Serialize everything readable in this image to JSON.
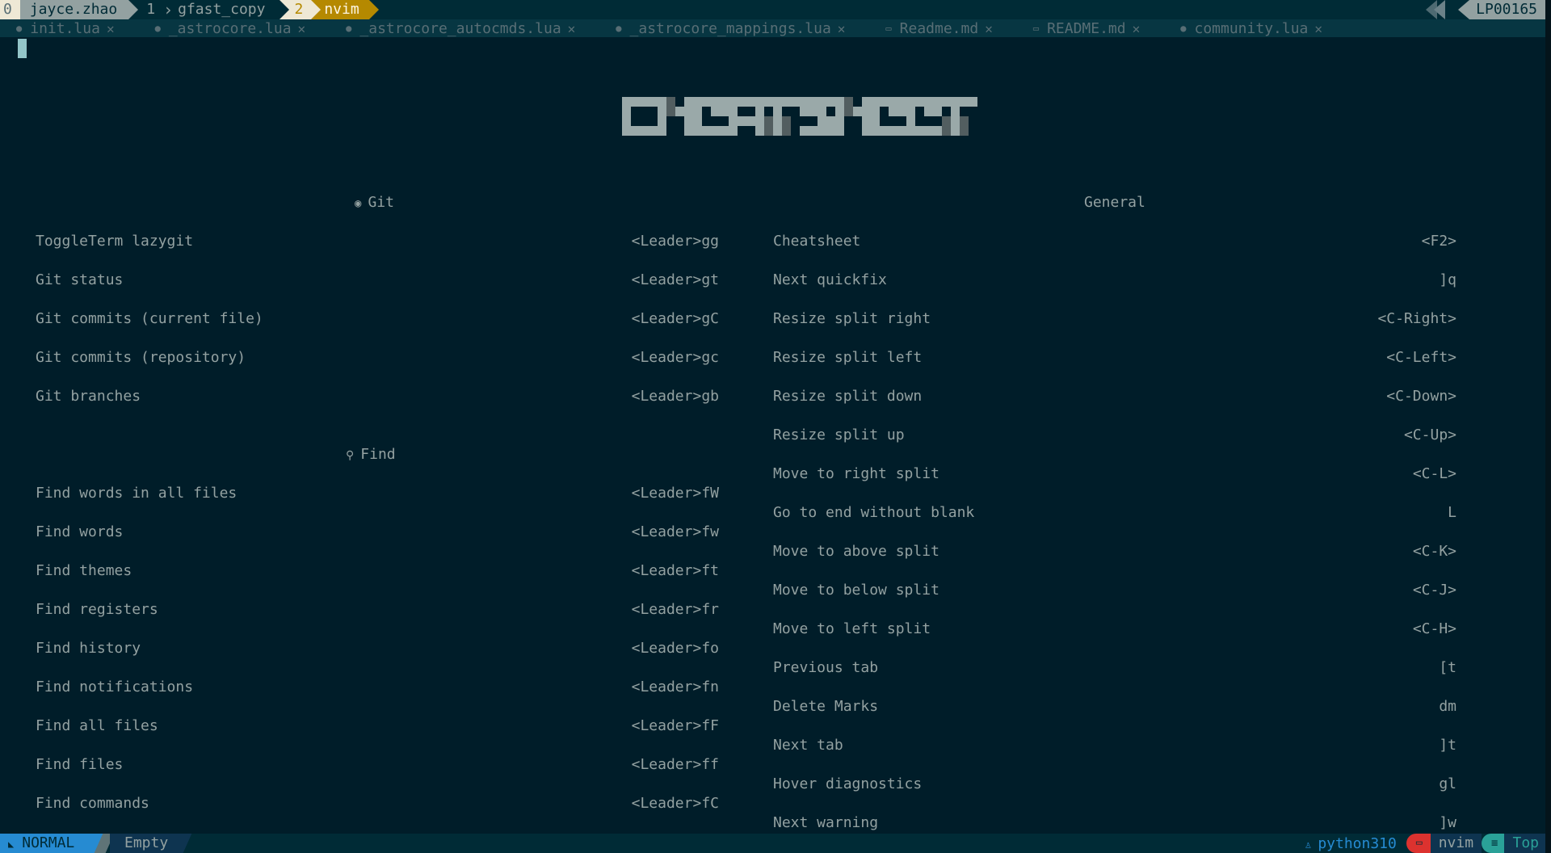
{
  "tmux": {
    "windows": [
      {
        "index": "0",
        "name": "jayce.zhao",
        "state": "inactive"
      },
      {
        "index": "1",
        "name": "gfast_copy",
        "state": "inactive"
      },
      {
        "index": "2",
        "name": "nvim",
        "state": "active"
      }
    ],
    "hostname": "LP00165"
  },
  "tabline": {
    "tabs": [
      {
        "icon": "lua-file-icon",
        "name": "init.lua"
      },
      {
        "icon": "lua-file-icon",
        "name": "_astrocore.lua"
      },
      {
        "icon": "lua-file-icon",
        "name": "_astrocore_autocmds.lua"
      },
      {
        "icon": "lua-file-icon",
        "name": "_astrocore_mappings.lua"
      },
      {
        "icon": "markdown-file-icon",
        "name": "Readme.md"
      },
      {
        "icon": "markdown-file-icon",
        "name": "README.md"
      },
      {
        "icon": "lua-file-icon",
        "name": "community.lua"
      }
    ],
    "close_glyph": "✕"
  },
  "cheatsheet": {
    "title": "CHEATSHEET",
    "sections": {
      "git": {
        "icon": "github-icon",
        "title": "Git",
        "items": [
          {
            "desc": "ToggleTerm lazygit",
            "key": "<Leader>gg"
          },
          {
            "desc": "Git status",
            "key": "<Leader>gt"
          },
          {
            "desc": "Git commits (current file)",
            "key": "<Leader>gC"
          },
          {
            "desc": "Git commits (repository)",
            "key": "<Leader>gc"
          },
          {
            "desc": "Git branches",
            "key": "<Leader>gb"
          }
        ]
      },
      "find": {
        "icon": "search-icon",
        "title": "Find",
        "items": [
          {
            "desc": "Find words in all files",
            "key": "<Leader>fW"
          },
          {
            "desc": "Find words",
            "key": "<Leader>fw"
          },
          {
            "desc": "Find themes",
            "key": "<Leader>ft"
          },
          {
            "desc": "Find registers",
            "key": "<Leader>fr"
          },
          {
            "desc": "Find history",
            "key": "<Leader>fo"
          },
          {
            "desc": "Find notifications",
            "key": "<Leader>fn"
          },
          {
            "desc": "Find all files",
            "key": "<Leader>fF"
          },
          {
            "desc": "Find files",
            "key": "<Leader>ff"
          },
          {
            "desc": "Find commands",
            "key": "<Leader>fC"
          }
        ]
      },
      "general": {
        "title": "General",
        "items": [
          {
            "desc": "Cheatsheet",
            "key": "<F2>"
          },
          {
            "desc": "Next quickfix",
            "key": "]q"
          },
          {
            "desc": "Resize split right",
            "key": "<C-Right>"
          },
          {
            "desc": "Resize split left",
            "key": "<C-Left>"
          },
          {
            "desc": "Resize split down",
            "key": "<C-Down>"
          },
          {
            "desc": "Resize split up",
            "key": "<C-Up>"
          },
          {
            "desc": "Move to right split",
            "key": "<C-L>"
          },
          {
            "desc": "Go to end without blank",
            "key": "L"
          },
          {
            "desc": "Move to above split",
            "key": "<C-K>"
          },
          {
            "desc": "Move to below split",
            "key": "<C-J>"
          },
          {
            "desc": "Move to left split",
            "key": "<C-H>"
          },
          {
            "desc": "Previous tab",
            "key": "[t"
          },
          {
            "desc": "Delete Marks",
            "key": "dm"
          },
          {
            "desc": "Next tab",
            "key": "]t"
          },
          {
            "desc": "Hover diagnostics",
            "key": "gl"
          },
          {
            "desc": "Next warning",
            "key": "]w"
          }
        ]
      }
    }
  },
  "statusline": {
    "mode": "NORMAL",
    "filename": "Empty",
    "venv": "python310",
    "cwd": "nvim",
    "position": "Top"
  },
  "colors": {
    "background": "#001d29",
    "foreground": "#93a1a1",
    "mode_normal": "#268bd2",
    "tmux_active": "#b58900",
    "dir_pill": "#dc322f",
    "pos_pill": "#2aa198"
  }
}
